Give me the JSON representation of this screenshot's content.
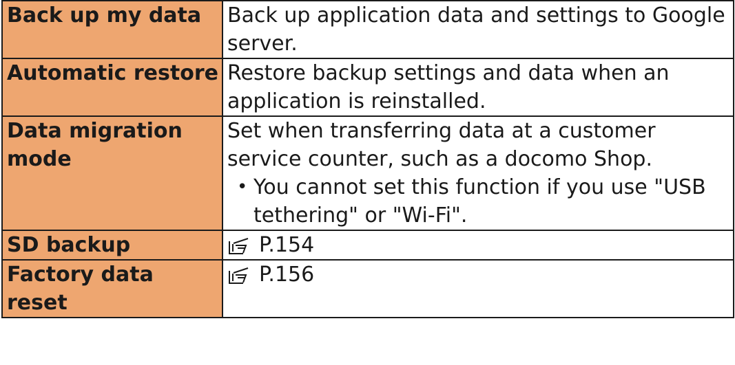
{
  "rows": [
    {
      "name": "Back up my data",
      "desc": "Back up application data and settings to Google server."
    },
    {
      "name": "Automatic restore",
      "desc": "Restore backup settings and data when an application is reinstalled."
    },
    {
      "name": "Data migration mode",
      "desc": "Set when transferring data at a customer service counter, such as a docomo Shop.",
      "note_bullet": "•",
      "note": "You cannot set this function if you use \"USB tethering\" or \"Wi-Fi\"."
    },
    {
      "name": "SD backup",
      "ref_icon": "pointing-hand-icon",
      "ref": "P.154"
    },
    {
      "name": "Factory data reset",
      "ref_icon": "pointing-hand-icon",
      "ref": "P.156"
    }
  ],
  "colors": {
    "label_background": "#eea670",
    "border": "#1a1a1a"
  }
}
